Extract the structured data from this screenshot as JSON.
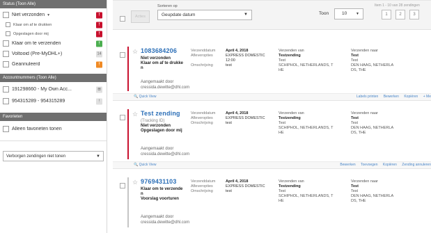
{
  "sidebar": {
    "status_header": "Status (Toon Alle)",
    "status_items": [
      {
        "label": "Niet verzonden",
        "caret": "▼",
        "badge": "!",
        "badge_color": "red"
      },
      {
        "label": "Klaar om af te drukken",
        "sub": true,
        "badge": "!",
        "badge_color": "red"
      },
      {
        "label": "Opgeslagen door mij",
        "sub": true,
        "badge": "!",
        "badge_color": "red"
      },
      {
        "label": "Klaar om te verzenden",
        "badge": "!",
        "badge_color": "green"
      },
      {
        "label": "Voltooid (Pre-MyDHL+)",
        "badge": "14",
        "badge_color": "grey"
      },
      {
        "label": "Geannuleerd",
        "badge": "!",
        "badge_color": "orange"
      }
    ],
    "accounts_header": "Accountnummers (Toon Alle)",
    "account_items": [
      {
        "label": "191298660 - My Own Acc...",
        "badge": "⊞",
        "badge_color": "grey"
      },
      {
        "label": "954315289 - 954315289",
        "badge": "!",
        "badge_color": "grey"
      }
    ],
    "favorites_header": "Favorieten",
    "favorites_item": "Alleen favorieten tonen",
    "hidden_select": "Verborgen zendingen niet tonen",
    "select_arrow": "▼"
  },
  "toolbar": {
    "action_button": "Acties",
    "sort_label": "Sorteren op",
    "sort_value": "Geupdate datum",
    "sort_arrow": "▼",
    "show_label": "Toon",
    "show_value": "10",
    "show_arrow": "▼",
    "page_info": "Item 1 - 10 van 28 zendingen",
    "pages": [
      "1",
      "2",
      "3"
    ]
  },
  "shipments": [
    {
      "tracking": "1083684206",
      "status_lines": [
        "Niet verzonden",
        "Klaar om af te drukke",
        "n"
      ],
      "field_labels": [
        "Verzenddatum",
        "Afleveropties",
        "",
        "Omschrijving"
      ],
      "date": "April 4, 2018",
      "service": "EXPRESS DOMESTIC",
      "time": "12:00",
      "description": "test",
      "from_header": "Verzenden van",
      "from_lines": [
        "Testzending",
        "Test",
        "SCHIPHOL, NETHERLANDS, T",
        "HE"
      ],
      "to_header": "Verzenden naar",
      "to_lines": [
        "Test",
        "Test",
        "DEN HAAG, NETHERLA",
        "DS, THE"
      ],
      "created_label": "Aangemaakt door",
      "created_by": "cressida.dewitte@dhl.com",
      "quick_view": "Quick View",
      "actions": [
        "Labels printen",
        "Bewerken",
        "Kopiëren",
        "+ Me"
      ],
      "bar_color": "red"
    },
    {
      "tracking": "Test zending",
      "status_lines": [
        "(Tracking ID)",
        "Niet verzonden",
        "Opgeslagen door mij"
      ],
      "field_labels": [
        "Verzenddatum",
        "Afleveropties",
        "Omschrijving"
      ],
      "date": "April 4, 2018",
      "service": "EXPRESS DOMESTIC",
      "description": "test",
      "from_header": "Verzenden van",
      "from_lines": [
        "Testzending",
        "Test",
        "SCHIPHOL, NETHERLANDS, T",
        "HE"
      ],
      "to_header": "Verzenden naar",
      "to_lines": [
        "Test",
        "Test",
        "DEN HAAG, NETHERLA",
        "DS, THE"
      ],
      "created_label": "Aangemaakt door",
      "created_by": "cressida.dewitte@dhl.com",
      "quick_view": "Quick View",
      "actions": [
        "Bewerken",
        "Toevoegen",
        "Kopiëren",
        "Zending annuleren"
      ],
      "bar_color": "red"
    },
    {
      "tracking": "9769431103",
      "status_lines": [
        "Klaar om te verzende",
        "n",
        "Voorslag voorturen"
      ],
      "field_labels": [
        "Verzenddatum",
        "Afleveropties",
        "Omschrijving"
      ],
      "date": "April 4, 2018",
      "service": "EXPRESS DOMESTIC",
      "description": "test",
      "from_header": "Verzenden van",
      "from_lines": [
        "Testzending",
        "Test",
        "SCHIPHOL, NETHERLANDS, T",
        "HE"
      ],
      "to_header": "Verzenden naar",
      "to_lines": [
        "Test",
        "Test",
        "DEN HAAG, NETHERLA",
        "DS, THE"
      ],
      "created_label": "Aangemaakt door",
      "created_by": "cressida.dewitte@dhl.com",
      "bar_color": "grey"
    }
  ],
  "colors": {
    "brand_red": "#c8102e",
    "link_blue": "#2c6fb7",
    "success_green": "#4caf50",
    "warning_orange": "#f08a24"
  }
}
